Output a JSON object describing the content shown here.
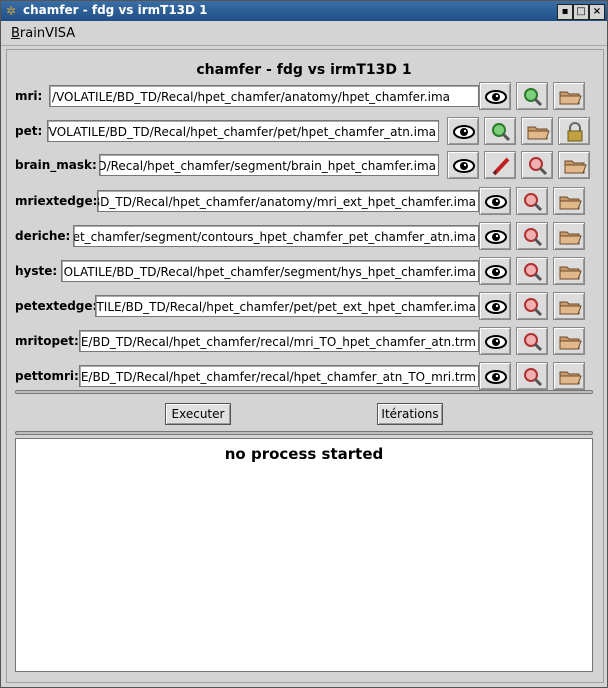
{
  "window": {
    "title": "chamfer - fdg vs irmT13D 1"
  },
  "menu": {
    "brainvisa_first": "B",
    "brainvisa_rest": "rainVISA"
  },
  "panel": {
    "title": "chamfer - fdg vs irmT13D 1"
  },
  "rows": [
    {
      "label": "mri:",
      "value": "/VOLATILE/BD_TD/Recal/hpet_chamfer/anatomy/hpet_chamfer.ima"
    },
    {
      "label": "pet:",
      "value": "/VOLATILE/BD_TD/Recal/hpet_chamfer/pet/hpet_chamfer_atn.ima"
    },
    {
      "label": "brain_mask:",
      "value": "TD/Recal/hpet_chamfer/segment/brain_hpet_chamfer.ima"
    },
    {
      "label": "mriextedge:",
      "value": "BD_TD/Recal/hpet_chamfer/anatomy/mri_ext_hpet_chamfer.ima"
    },
    {
      "label": "deriche:",
      "value": "hpet_chamfer/segment/contours_hpet_chamfer_pet_chamfer_atn.ima"
    },
    {
      "label": "hyste:",
      "value": "OLATILE/BD_TD/Recal/hpet_chamfer/segment/hys_hpet_chamfer.ima"
    },
    {
      "label": "petextedge:",
      "value": ",TILE/BD_TD/Recal/hpet_chamfer/pet/pet_ext_hpet_chamfer.ima"
    },
    {
      "label": "mritopet:",
      "value": ".E/BD_TD/Recal/hpet_chamfer/recal/mri_TO_hpet_chamfer_atn.trm"
    },
    {
      "label": "pettomri:",
      "value": ".E/BD_TD/Recal/hpet_chamfer/recal/hpet_chamfer_atn_TO_mri.trm"
    }
  ],
  "buttons": {
    "execute": "Executer",
    "iterations": "Itérations"
  },
  "log": {
    "message": "no process started"
  },
  "icons": {
    "view": "eye-icon",
    "search_green": "magnifier-green-icon",
    "search_red": "magnifier-red-icon",
    "browse": "folder-icon",
    "lock": "lock-icon",
    "edit": "pencil-icon"
  }
}
